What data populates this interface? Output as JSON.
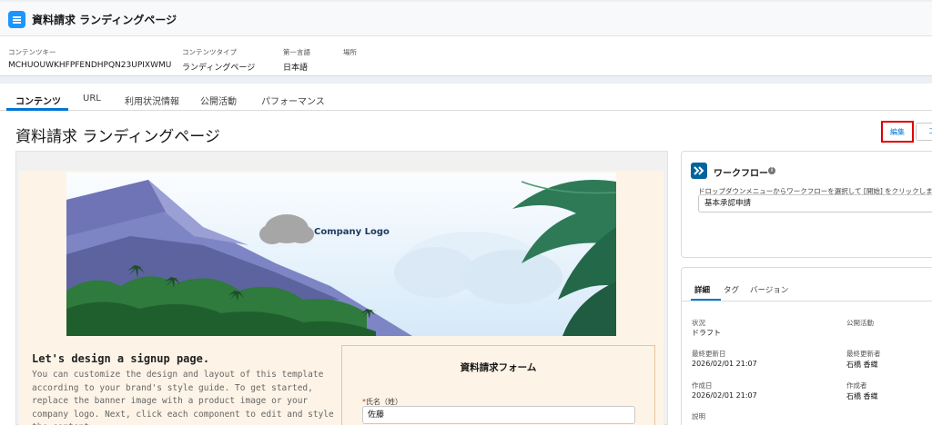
{
  "header": {
    "title": "資料請求 ランディングページ",
    "meta": [
      {
        "key": "コンテンツキー",
        "value": "MCHUOUWKHFPFENDHPQN23UPIXWMU"
      },
      {
        "key": "コンテンツタイプ",
        "value": "ランディングページ"
      },
      {
        "key": "第一言語",
        "value": "日本語"
      },
      {
        "key": "場所",
        "value": ""
      }
    ]
  },
  "tabs": [
    {
      "label": "コンテンツ",
      "active": true
    },
    {
      "label": "URL",
      "active": false
    },
    {
      "label": "利用状況情報",
      "active": false
    },
    {
      "label": "公開活動",
      "active": false
    },
    {
      "label": "パフォーマンス",
      "active": false
    }
  ],
  "page": {
    "title": "資料請求 ランディングページ",
    "edit_label": "編集",
    "other_label": "コ"
  },
  "preview": {
    "logo_text": "Company Logo",
    "signup_heading": "Let's design a signup page.",
    "signup_body": "You can customize the design and layout of this template according to your brand's style guide. To get started, replace the banner image with a product image or your company logo. Next, click each component to edit and style the content.",
    "form": {
      "title": "資料請求フォーム",
      "field_label": "氏名（姓）",
      "required_mark": "*",
      "field_value": "佐藤"
    }
  },
  "workflow": {
    "title": "ワークフロー",
    "description": "ドロップダウンメニューからワークフローを選択して [開始] をクリックしま",
    "selected": "基本承認申請"
  },
  "details": {
    "tabs": [
      {
        "label": "詳細",
        "active": true
      },
      {
        "label": "タグ",
        "active": false
      },
      {
        "label": "バージョン",
        "active": false
      }
    ],
    "fields": {
      "status_key": "状況",
      "status_value": "ドラフト",
      "publish_key": "公開活動",
      "publish_value": "",
      "updated_key": "最終更新日",
      "updated_value": "2026/02/01 21:07",
      "updater_key": "最終更新者",
      "updater_value": "石橋 香織",
      "created_key": "作成日",
      "created_value": "2026/02/01 21:07",
      "creator_key": "作成者",
      "creator_value": "石橋 香織",
      "desc_key": "説明"
    }
  },
  "colors": {
    "brand": "#0176d3",
    "highlight": "#e10000",
    "preview_bg": "#fdf4e7"
  }
}
